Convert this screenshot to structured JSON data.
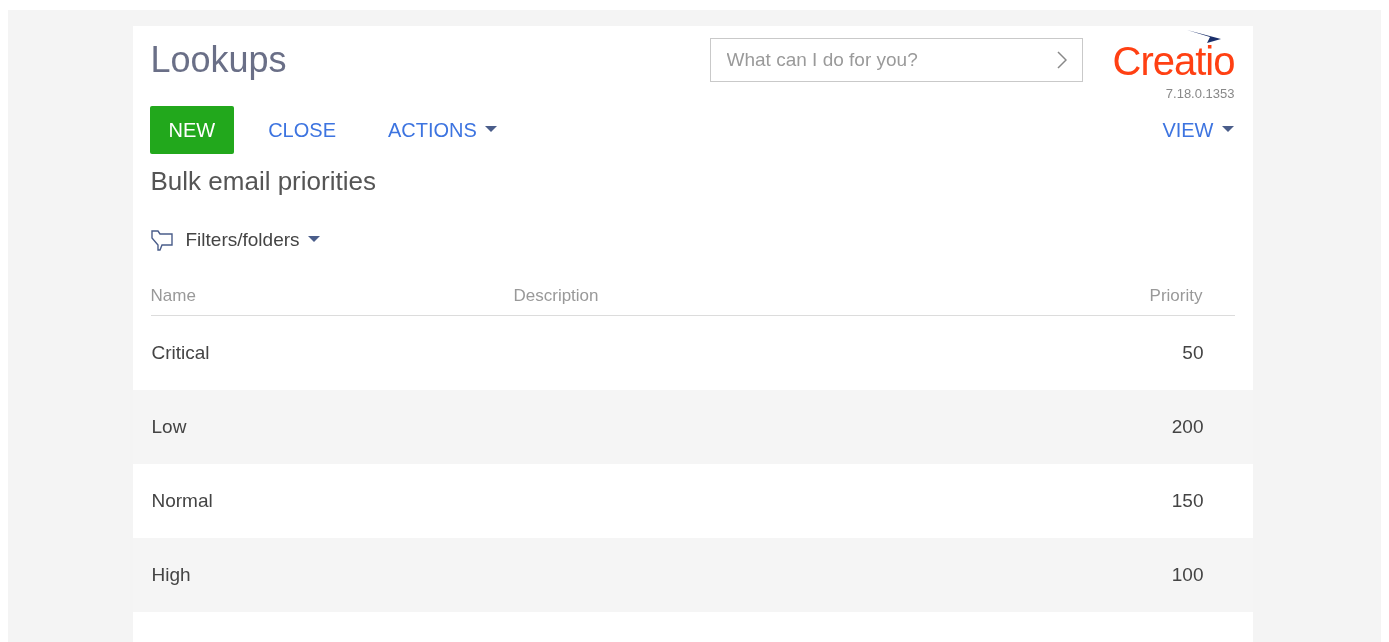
{
  "page_title": "Lookups",
  "search": {
    "placeholder": "What can I do for you?"
  },
  "logo": {
    "text": "Creatio",
    "version": "7.18.0.1353"
  },
  "toolbar": {
    "buttons": [
      {
        "label": "NEW",
        "kind": "primary"
      },
      {
        "label": "CLOSE",
        "kind": "link"
      },
      {
        "label": "ACTIONS",
        "kind": "menu"
      }
    ],
    "view": "VIEW"
  },
  "section_title": "Bulk email priorities",
  "filters": "Filters/folders",
  "table": {
    "columns": [
      "Name",
      "Description",
      "Priority"
    ],
    "rows": [
      {
        "name": "Critical",
        "priority": "50"
      },
      {
        "name": "Low",
        "priority": "200"
      },
      {
        "name": "Normal",
        "priority": "150"
      },
      {
        "name": "High",
        "priority": "100"
      }
    ]
  }
}
